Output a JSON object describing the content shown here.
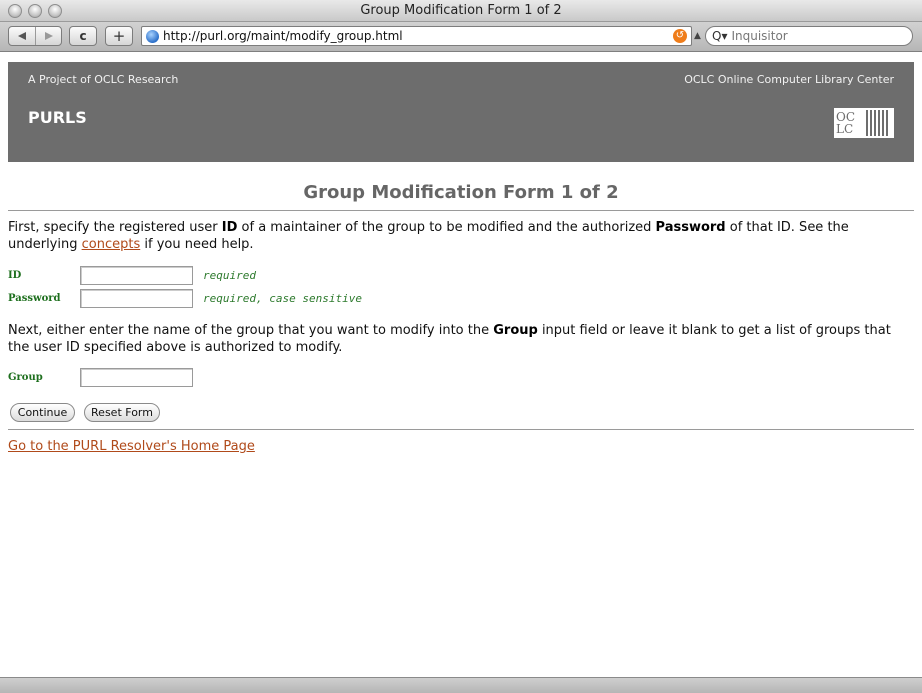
{
  "window": {
    "title": "Group Modification Form 1 of 2"
  },
  "toolbar": {
    "back_icon": "back-arrow",
    "forward_icon": "forward-arrow",
    "reload_glyph": "c",
    "add_glyph": "+",
    "url": "http://purl.org/maint/modify_group.html",
    "search_placeholder": "Inquisitor",
    "search_glyph": "Q▾"
  },
  "banner": {
    "project": "A Project of OCLC Research",
    "org": "OCLC Online Computer Library Center",
    "title": "PURLS",
    "logo_line1": "OC",
    "logo_line2": "LC"
  },
  "main": {
    "heading": "Group Modification Form 1 of 2",
    "intro": {
      "t1": "First, specify the registered user ",
      "b1": "ID",
      "t2": " of a maintainer of the group to be modified and the authorized ",
      "b2": "Password",
      "t3": " of that ID. See the underlying ",
      "link": "concepts",
      "t4": " if you need help."
    },
    "fields": {
      "id_label": "ID",
      "id_hint": "required",
      "password_label": "Password",
      "password_hint": "required, case sensitive",
      "group_label": "Group"
    },
    "next": {
      "t1": "Next, either enter the name of the group that you want to modify into the ",
      "b1": "Group",
      "t2": " input field or leave it blank to get a list of groups that the user ID specified above is authorized to modify."
    },
    "buttons": {
      "continue": "Continue",
      "reset": "Reset Form"
    },
    "home_link": "Go to the PURL Resolver's Home Page "
  }
}
